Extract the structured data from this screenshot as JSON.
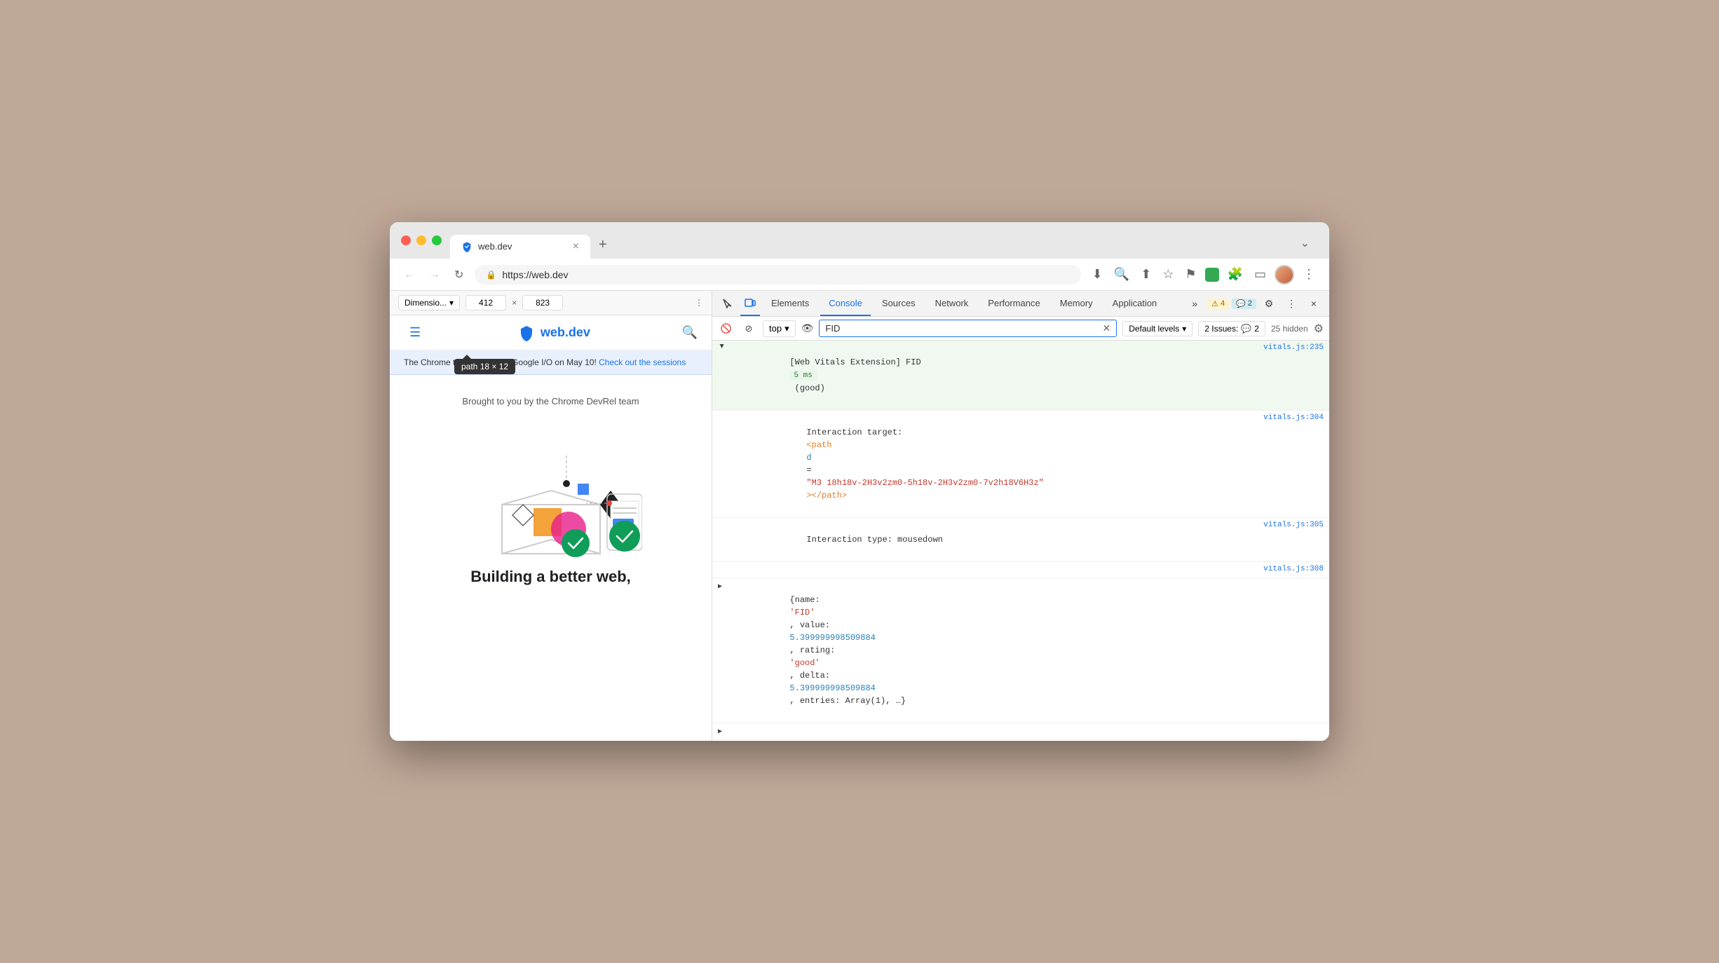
{
  "browser": {
    "tab": {
      "title": "web.dev",
      "favicon_label": "web-dev-favicon"
    },
    "url": "https://web.dev",
    "dimensions": {
      "width": "412",
      "height": "823"
    }
  },
  "toolbar": {
    "back": "←",
    "forward": "→",
    "reload": "↻",
    "more": "⋮",
    "new_tab": "+",
    "chevron": "⌄"
  },
  "webpage": {
    "logo_text": "web.dev",
    "nav_icon": "≡",
    "search_icon": "🔍",
    "tooltip": "path  18 × 12",
    "chrome_notice": "The Chrome team is back at Google I/O on May 10!",
    "chrome_notice_link_text": "Check out the sessions",
    "promo_text": "Brought to you by the Chrome DevRel team",
    "hero_text": "Building a better web,"
  },
  "devtools": {
    "tabs": {
      "elements": "Elements",
      "console": "Console",
      "sources": "Sources",
      "network": "Network",
      "performance": "Performance",
      "memory": "Memory",
      "application": "Application"
    },
    "active_tab": "Console",
    "badges": {
      "warn_count": "4",
      "warn_icon": "⚠",
      "info_count": "2",
      "info_icon": "💬"
    },
    "console_toolbar": {
      "context": "top",
      "filter_value": "FID",
      "default_levels": "Default levels",
      "issues_label": "2 Issues:",
      "issues_count": "2",
      "hidden_count": "25 hidden"
    },
    "console_entries": [
      {
        "id": "entry1",
        "type": "log",
        "expanded": true,
        "prefix": "[Web Vitals Extension] FID",
        "metric_value": "5 ms",
        "metric_rating": "(good)",
        "source_file": "vitals.js:235",
        "children": [
          {
            "label": "Interaction target:",
            "value": "<path d=\"M3 18h18v-2H3v2zm0-5h18v-2H3v2zm0-7v2h18V6H3z\"></path>",
            "source_file": "vitals.js:304"
          },
          {
            "label": "Interaction type:",
            "value": "mousedown",
            "source_file": "vitals.js:305"
          },
          {
            "source_file": "vitals.js:308"
          },
          {
            "label": "{name: 'FID', value:",
            "value": "5.399999998509884",
            "value2": ", rating: 'good', delta:",
            "value3": "5.399999998509884",
            "value4": ", entries: Array(1), …}",
            "source_file": ""
          }
        ]
      }
    ],
    "prompt_placeholder": ""
  }
}
